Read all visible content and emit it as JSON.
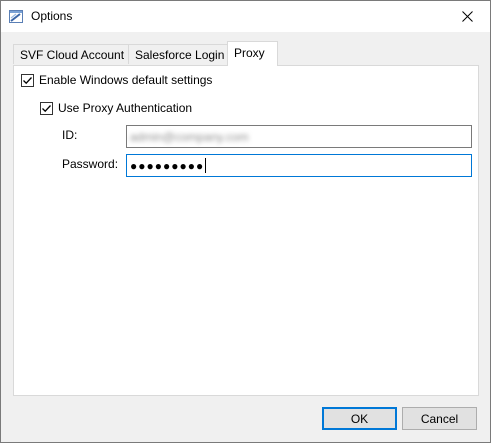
{
  "window": {
    "title": "Options",
    "icon": "options-window-icon",
    "close_icon": "close-icon"
  },
  "tabs": [
    {
      "label": "SVF Cloud Account",
      "active": false
    },
    {
      "label": "Salesforce Login",
      "active": false
    },
    {
      "label": "Proxy",
      "active": true
    }
  ],
  "proxy": {
    "enable_windows_default": {
      "label": "Enable Windows default settings",
      "checked": true
    },
    "use_proxy_auth": {
      "label": "Use Proxy Authentication",
      "checked": true
    },
    "id": {
      "label": "ID:",
      "value": "admin@company.com"
    },
    "password": {
      "label": "Password:",
      "value": "●●●●●●●●●"
    }
  },
  "buttons": {
    "ok": "OK",
    "cancel": "Cancel"
  },
  "colors": {
    "focus_border": "#0078d7",
    "button_face": "#e1e1e1",
    "dialog_bg": "#f0f0f0"
  }
}
